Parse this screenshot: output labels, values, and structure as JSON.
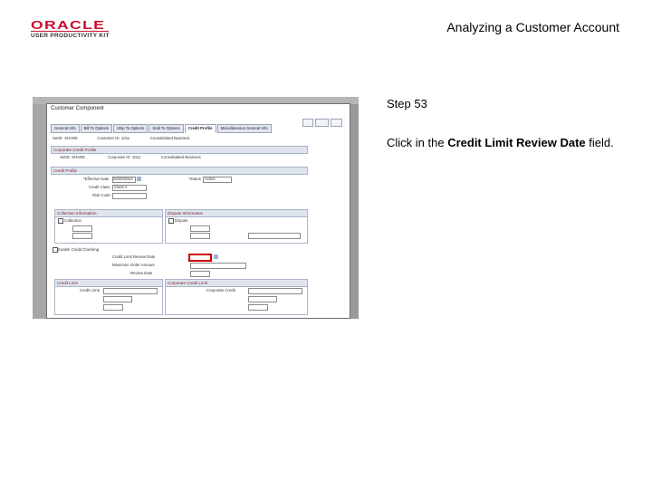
{
  "header": {
    "logo_oracle": "ORACLE",
    "logo_sub": "USER PRODUCTIVITY KIT",
    "title": "Analyzing a Customer Account"
  },
  "step": {
    "label": "Step 53"
  },
  "instruction": {
    "prefix": "Click in the ",
    "field_name": "Credit Limit Review Date",
    "suffix": " field."
  },
  "screenshot": {
    "window_title": "Customer Component",
    "tabs": [
      "General Info",
      "Bill To Options",
      "Ship To Options",
      "Sold To Options",
      "Credit Profile",
      "Miscellaneous General Info"
    ],
    "active_tab": "Credit Profile",
    "sections": {
      "corporate_credit": "Corporate Credit Profile",
      "credit_profile": "Credit Profile",
      "collection": "Collection Information",
      "dispute": "Dispute Information",
      "credit_limit": "Credit Limit",
      "corporate_limit": "Corporate Credit Limit"
    },
    "labels": {
      "effective_date": "*Effective Date",
      "credit_class": "Credit Class",
      "risk_code": "Risk Code",
      "status": "*Status",
      "enable_credit_checking": "Enable Credit Checking",
      "credit_limit_review_date": "Credit Limit Review Date",
      "max_order_amount": "Maximum Order Amount",
      "review_date": "Review Date",
      "collection": "Collection",
      "dispute": "Dispute",
      "credit_limit": "Credit Limit",
      "corporate_credit": "Corporate Credit"
    },
    "values": {
      "effective_date": "04/25/2013",
      "credit_class": "Class A",
      "status": "Active"
    }
  },
  "colors": {
    "oracle_red": "#c8102e",
    "highlight_red": "#d00000"
  }
}
